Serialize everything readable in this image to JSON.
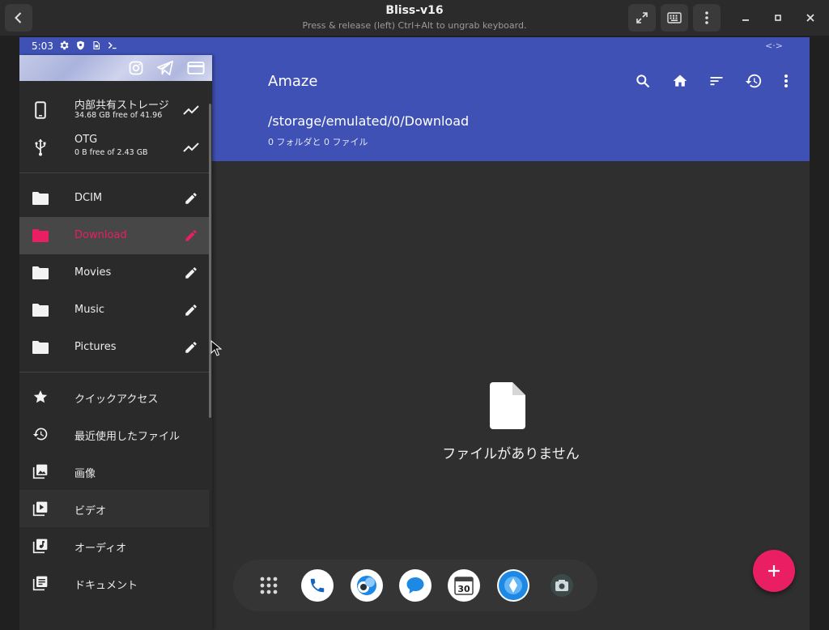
{
  "window": {
    "title": "Bliss-v16",
    "subtitle": "Press & release (left) Ctrl+Alt to ungrab keyboard."
  },
  "statusbar": {
    "time": "5:03",
    "icons": [
      "gear-icon",
      "shield-icon",
      "sim-icon",
      "terminal-icon"
    ]
  },
  "appbar": {
    "title": "Amaze",
    "path": "/storage/emulated/0/Download",
    "summary": "0 フォルダと 0 ファイル",
    "actions": [
      "search-icon",
      "home-icon",
      "sort-icon",
      "history-icon",
      "more-vert-icon"
    ]
  },
  "drawer": {
    "storage": [
      {
        "label": "内部共有ストレージ",
        "detail": "34.68 GB free of 41.96",
        "icon": "phone-icon"
      },
      {
        "label": "OTG",
        "detail": "0 B free of 2.43 GB",
        "icon": "usb-icon"
      }
    ],
    "folders": [
      {
        "label": "DCIM"
      },
      {
        "label": "Download",
        "selected": true
      },
      {
        "label": "Movies"
      },
      {
        "label": "Music"
      },
      {
        "label": "Pictures"
      }
    ],
    "categories": [
      {
        "label": "クイックアクセス",
        "icon": "star-icon"
      },
      {
        "label": "最近使用したファイル",
        "icon": "history-icon"
      },
      {
        "label": "画像",
        "icon": "image-icon"
      },
      {
        "label": "ビデオ",
        "icon": "video-library-icon"
      },
      {
        "label": "オーディオ",
        "icon": "audio-library-icon"
      },
      {
        "label": "ドキュメント",
        "icon": "document-icon"
      }
    ]
  },
  "empty_state": {
    "message": "ファイルがありません"
  },
  "dock": [
    "apps-grid-icon",
    "phone-app-icon",
    "browser-app-icon",
    "messages-app-icon",
    "calendar-app-icon",
    "maps-app-icon",
    "camera-app-icon"
  ],
  "calendar_day": "30",
  "colors": {
    "primary": "#3f51b5",
    "accent": "#e91e63",
    "background": "#2f2f2f",
    "drawer": "#2a2a2a"
  }
}
